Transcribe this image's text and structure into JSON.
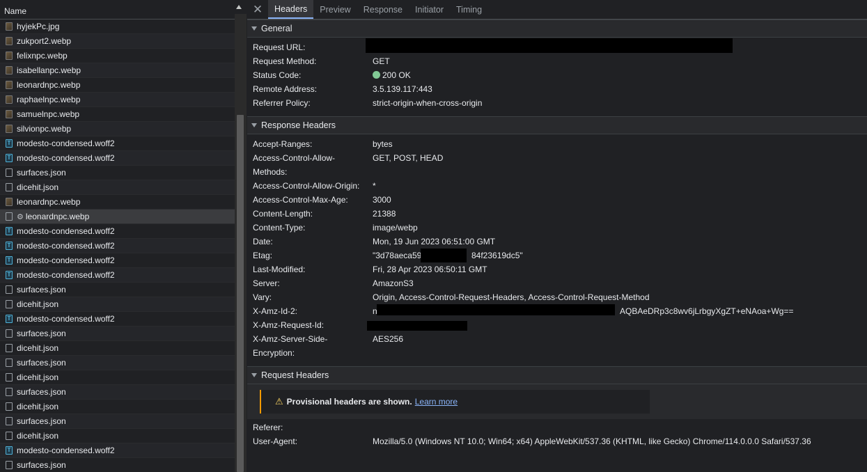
{
  "network_list": {
    "column_header": "Name",
    "rows": [
      {
        "name": "hyjekPc.jpg",
        "icon": "image-file-icon"
      },
      {
        "name": "zukport2.webp",
        "icon": "image-file-icon"
      },
      {
        "name": "felixnpc.webp",
        "icon": "image-file-icon"
      },
      {
        "name": "isabellanpc.webp",
        "icon": "image-file-icon"
      },
      {
        "name": "leonardnpc.webp",
        "icon": "image-file-icon"
      },
      {
        "name": "raphaelnpc.webp",
        "icon": "image-file-icon"
      },
      {
        "name": "samuelnpc.webp",
        "icon": "image-file-icon"
      },
      {
        "name": "silvionpc.webp",
        "icon": "image-file-icon"
      },
      {
        "name": "modesto-condensed.woff2",
        "icon": "font-file-icon"
      },
      {
        "name": "modesto-condensed.woff2",
        "icon": "font-file-icon"
      },
      {
        "name": "surfaces.json",
        "icon": "document-file-icon"
      },
      {
        "name": "dicehit.json",
        "icon": "document-file-icon"
      },
      {
        "name": "leonardnpc.webp",
        "icon": "image-file-icon"
      },
      {
        "name": "leonardnpc.webp",
        "icon": "document-file-icon",
        "selected": true,
        "gear": "⚙"
      },
      {
        "name": "modesto-condensed.woff2",
        "icon": "font-file-icon"
      },
      {
        "name": "modesto-condensed.woff2",
        "icon": "font-file-icon"
      },
      {
        "name": "modesto-condensed.woff2",
        "icon": "font-file-icon"
      },
      {
        "name": "modesto-condensed.woff2",
        "icon": "font-file-icon"
      },
      {
        "name": "surfaces.json",
        "icon": "document-file-icon"
      },
      {
        "name": "dicehit.json",
        "icon": "document-file-icon"
      },
      {
        "name": "modesto-condensed.woff2",
        "icon": "font-file-icon"
      },
      {
        "name": "surfaces.json",
        "icon": "document-file-icon"
      },
      {
        "name": "dicehit.json",
        "icon": "document-file-icon"
      },
      {
        "name": "surfaces.json",
        "icon": "document-file-icon"
      },
      {
        "name": "dicehit.json",
        "icon": "document-file-icon"
      },
      {
        "name": "surfaces.json",
        "icon": "document-file-icon"
      },
      {
        "name": "dicehit.json",
        "icon": "document-file-icon"
      },
      {
        "name": "surfaces.json",
        "icon": "document-file-icon"
      },
      {
        "name": "dicehit.json",
        "icon": "document-file-icon"
      },
      {
        "name": "modesto-condensed.woff2",
        "icon": "font-file-icon"
      },
      {
        "name": "surfaces.json",
        "icon": "document-file-icon"
      }
    ]
  },
  "tabs": {
    "close": "✕",
    "items": [
      "Headers",
      "Preview",
      "Response",
      "Initiator",
      "Timing"
    ],
    "active": "Headers"
  },
  "general": {
    "title": "General",
    "request_url_label": "Request URL:",
    "request_method_label": "Request Method:",
    "request_method": "GET",
    "status_code_label": "Status Code:",
    "status_code": "200 OK",
    "remote_address_label": "Remote Address:",
    "remote_address": "3.5.139.117:443",
    "referrer_policy_label": "Referrer Policy:",
    "referrer_policy": "strict-origin-when-cross-origin"
  },
  "response_headers": {
    "title": "Response Headers",
    "accept_ranges_label": "Accept-Ranges:",
    "accept_ranges": "bytes",
    "acam_label_1": "Access-Control-Allow-",
    "acam_label_2": "Methods:",
    "acam": "GET, POST, HEAD",
    "acao_label": "Access-Control-Allow-Origin:",
    "acao": "*",
    "acma_label": "Access-Control-Max-Age:",
    "acma": "3000",
    "content_length_label": "Content-Length:",
    "content_length": "21388",
    "content_type_label": "Content-Type:",
    "content_type": "image/webp",
    "date_label": "Date:",
    "date": "Mon, 19 Jun 2023 06:51:00 GMT",
    "etag_label": "Etag:",
    "etag_start": "\"3d78aeca59",
    "etag_end": "84f23619dc5\"",
    "last_modified_label": "Last-Modified:",
    "last_modified": "Fri, 28 Apr 2023 06:50:11 GMT",
    "server_label": "Server:",
    "server": "AmazonS3",
    "vary_label": "Vary:",
    "vary": "Origin, Access-Control-Request-Headers, Access-Control-Request-Method",
    "amz_id2_label": "X-Amz-Id-2:",
    "amz_id2_start": "n",
    "amz_id2_end": "AQBAeDRp3c8wv6jLrbgyXgZT+eNAoa+Wg==",
    "amz_req_id_label": "X-Amz-Request-Id:",
    "sse_label_1": "X-Amz-Server-Side-",
    "sse_label_2": "Encryption:",
    "sse": "AES256"
  },
  "request_headers": {
    "title": "Request Headers",
    "provisional_text": "Provisional headers are shown.",
    "learn_more": "Learn more",
    "referer_label": "Referer:",
    "user_agent_label": "User-Agent:",
    "user_agent": "Mozilla/5.0 (Windows NT 10.0; Win64; x64) AppleWebKit/537.36 (KHTML, like Gecko) Chrome/114.0.0.0 Safari/537.36"
  }
}
